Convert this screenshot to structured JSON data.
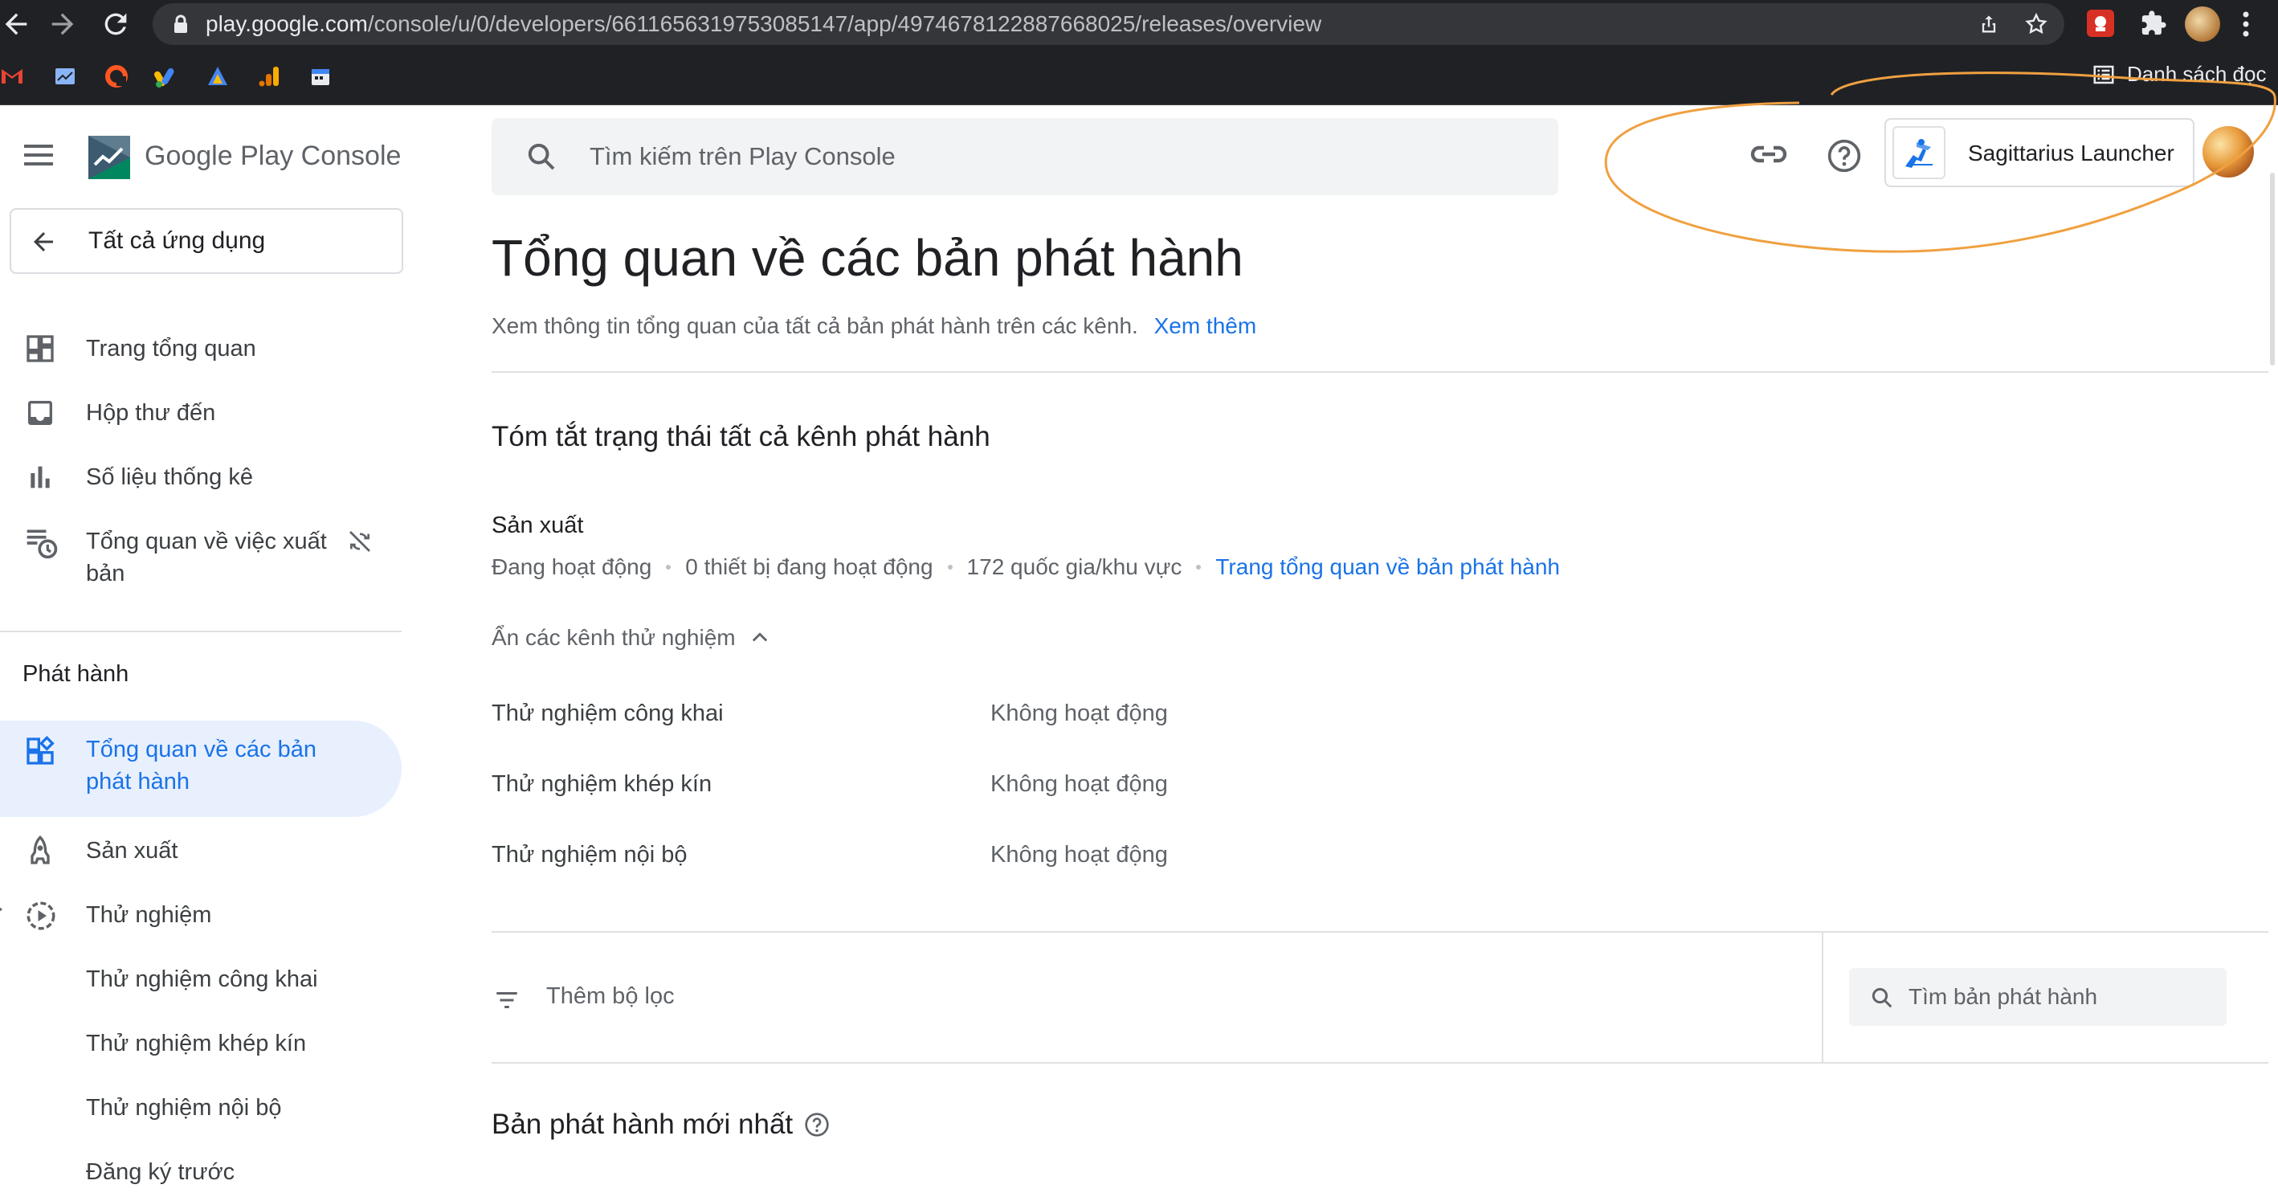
{
  "browser": {
    "url_host": "play.google.com",
    "url_path": "/console/u/0/developers/6611656319753085147/app/4974678122887668025/releases/overview",
    "bookmarks": [
      "gmail-icon",
      "analytics-icon",
      "red-logo-icon",
      "google-ads-icon",
      "ads-icon",
      "analytics-bars-icon",
      "calendar-icon"
    ],
    "reading_list_label": "Danh sách đọc"
  },
  "header": {
    "logo_text_a": "Google Play ",
    "logo_text_b": "Console",
    "search_placeholder": "Tìm kiếm trên Play Console",
    "app_name": "Sagittarius Launcher"
  },
  "sidebar": {
    "back_label": "Tất cả ứng dụng",
    "items": [
      {
        "label": "Trang tổng quan",
        "icon": "dashboard-icon"
      },
      {
        "label": "Hộp thư đến",
        "icon": "inbox-icon"
      },
      {
        "label": "Số liệu thống kê",
        "icon": "bar-chart-icon"
      },
      {
        "label_line1": "Tổng quan về việc xuất",
        "label_line2": "bản",
        "icon": "publishing-icon",
        "badge_icon": "sync-off-icon"
      }
    ],
    "section_title": "Phát hành",
    "release_items": [
      {
        "label_line1": "Tổng quan về các bản",
        "label_line2": "phát hành",
        "icon": "release-overview-icon",
        "active": true
      },
      {
        "label": "Sản xuất",
        "icon": "production-icon"
      },
      {
        "label": "Thử nghiệm",
        "icon": "testing-icon"
      },
      {
        "label": "Thử nghiệm công khai"
      },
      {
        "label": "Thử nghiệm khép kín"
      },
      {
        "label": "Thử nghiệm nội bộ"
      },
      {
        "label": "Đăng ký trước"
      }
    ]
  },
  "main": {
    "title": "Tổng quan về các bản phát hành",
    "subtitle": "Xem thông tin tổng quan của tất cả bản phát hành trên các kênh.",
    "learn_more": "Xem thêm",
    "summary_heading": "Tóm tắt trạng thái tất cả kênh phát hành",
    "production": {
      "label": "Sản xuất",
      "status": "Đang hoạt động",
      "devices": "0 thiết bị đang hoạt động",
      "countries": "172 quốc gia/khu vực",
      "link": "Trang tổng quan về bản phát hành"
    },
    "toggle_tests": "Ẩn các kênh thử nghiệm",
    "tracks": [
      {
        "name": "Thử nghiệm công khai",
        "status": "Không hoạt động"
      },
      {
        "name": "Thử nghiệm khép kín",
        "status": "Không hoạt động"
      },
      {
        "name": "Thử nghiệm nội bộ",
        "status": "Không hoạt động"
      }
    ],
    "filter_label": "Thêm bộ lọc",
    "release_search_placeholder": "Tìm bản phát hành",
    "latest_heading": "Bản phát hành mới nhất"
  },
  "colors": {
    "accent": "#1a73e8",
    "active_bg": "#e8f0fe",
    "annotation": "#f0a040"
  }
}
